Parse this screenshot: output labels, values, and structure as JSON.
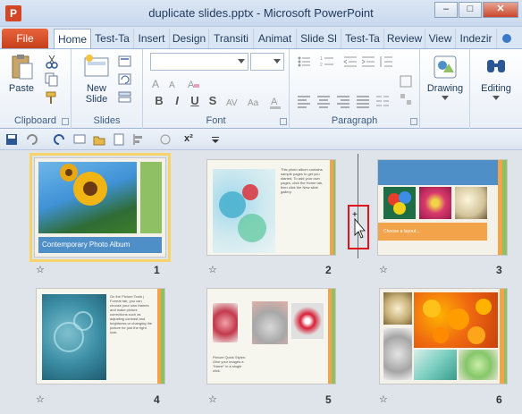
{
  "window": {
    "title": "duplicate slides.pptx - Microsoft PowerPoint",
    "app_icon_letter": "P",
    "minimize": "–",
    "maximize": "□",
    "close": "✕"
  },
  "ribbon_tabs": {
    "file": "File",
    "tabs": [
      "Home",
      "Test-Ta",
      "Insert",
      "Design",
      "Transiti",
      "Animat",
      "Slide Sl",
      "Test-Ta",
      "Review",
      "View",
      "Indezir"
    ]
  },
  "ribbon": {
    "clipboard": {
      "label": "Clipboard",
      "paste": "Paste"
    },
    "slides": {
      "label": "Slides",
      "new_slide_line1": "New",
      "new_slide_line2": "Slide"
    },
    "font": {
      "label": "Font"
    },
    "paragraph": {
      "label": "Paragraph"
    },
    "drawing": {
      "label": "Drawing"
    },
    "editing": {
      "label": "Editing"
    }
  },
  "qat": {
    "superscript": "x²"
  },
  "slides": [
    {
      "number": "1",
      "caption": "Contemporary Photo Album"
    },
    {
      "number": "2",
      "text": "This photo album contains sample pages to get you started. To add your own pages, click the Home tab, then click the New slide gallery."
    },
    {
      "number": "3",
      "caption": "Choose a layout..."
    },
    {
      "number": "4",
      "text": "On the Picture Tools | Format tab, you can choose your own frames and make picture corrections such as adjusting contrast and brightness or changing the picture for just the right look."
    },
    {
      "number": "5",
      "text": "Picture Quick Styles: Give your images a \"frame\" in a single click."
    },
    {
      "number": "6"
    }
  ],
  "colors": {
    "file_tab": "#d24726",
    "accent_green": "#8fc064",
    "accent_orange": "#f3a34a",
    "accent_blue": "#4e8fc8",
    "highlight": "#e0141b"
  }
}
